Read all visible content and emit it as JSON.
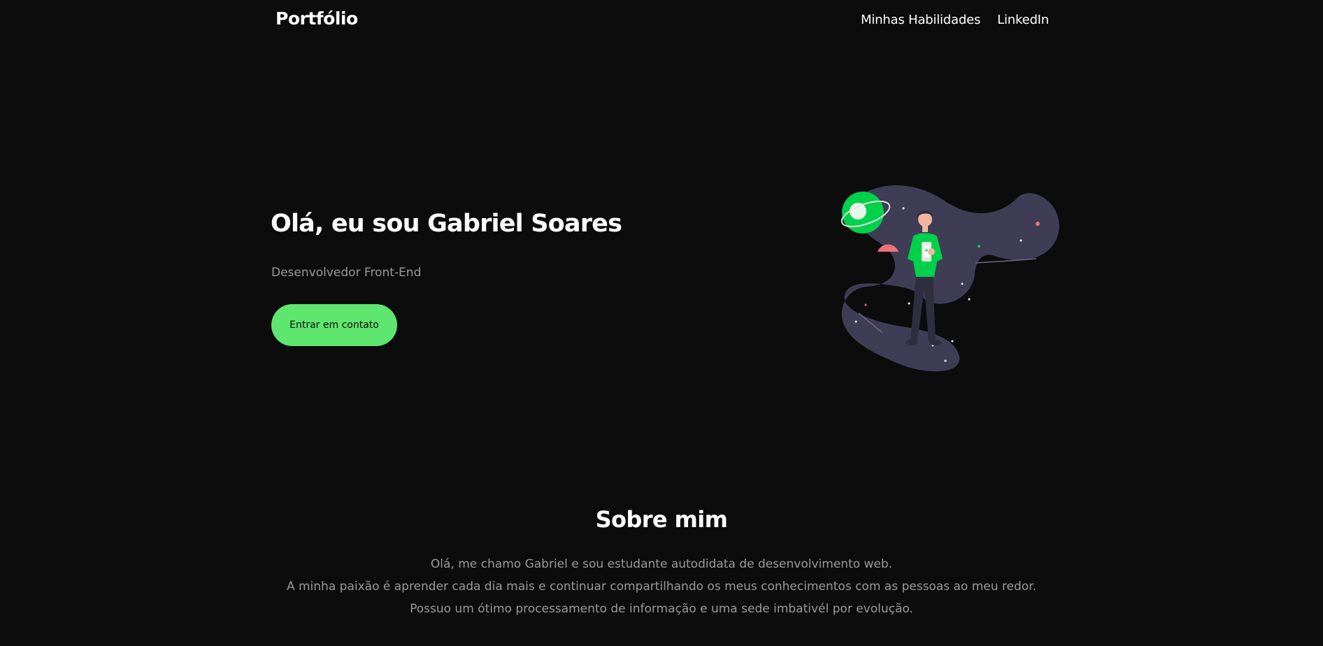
{
  "header": {
    "logo": "Portfólio",
    "nav": [
      "Minhas Habilidades",
      "LinkedIn"
    ]
  },
  "hero": {
    "title": "Olá, eu sou Gabriel Soares",
    "subtitle": "Desenvolvedor Front-End",
    "cta_label": "Entrar em contato"
  },
  "illustration": {
    "icon": "person-in-space-illustration",
    "colors": {
      "blob": "#3f3d56",
      "accent": "#00d14b",
      "planet_red": "#f07178",
      "skin": "#f2b6a0"
    }
  },
  "about": {
    "title": "Sobre mim",
    "lines": [
      "Olá, me chamo Gabriel e sou estudante autodidata de desenvolvimento web.",
      "A minha paixão é aprender cada dia mais e continuar compartilhando os meus conhecimentos com as pessoas ao meu redor.",
      "Possuo um ótimo processamento de informação e uma sede imbativél por evolução."
    ]
  },
  "colors": {
    "background": "#0c0c0c",
    "accent": "#5ee66e",
    "muted_text": "#9a9a9a"
  }
}
